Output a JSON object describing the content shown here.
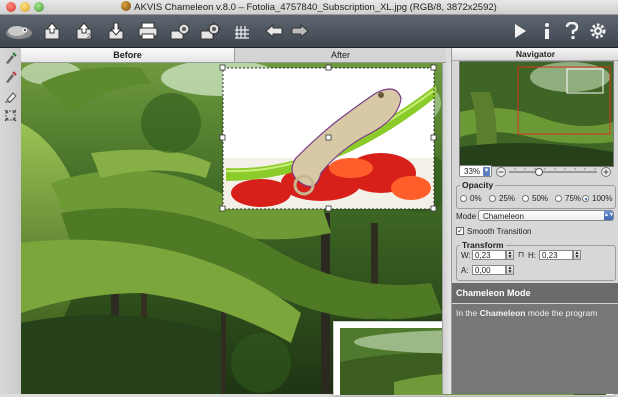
{
  "window": {
    "title": "AKVIS Chameleon v.8.0 – Fotolia_4757840_Subscription_XL.jpg (RGB/8, 3872x2592)"
  },
  "toolbar": {
    "left_icons": [
      "app-logo-icon",
      "open-icon",
      "save-icon",
      "import-icon",
      "print-icon",
      "preferences-icon",
      "settings-icon",
      "grid-icon",
      "undo-arrow-icon",
      "redo-arrow-icon"
    ],
    "right_icons": [
      "run-icon",
      "info-icon",
      "help-icon",
      "gear-icon"
    ]
  },
  "tabs": {
    "before": "Before",
    "after": "After"
  },
  "navigator": {
    "title": "Navigator",
    "zoom": "33%"
  },
  "opacity": {
    "label": "Opacity",
    "options": [
      "0%",
      "25%",
      "50%",
      "75%",
      "100%"
    ],
    "selected": "100%"
  },
  "mode": {
    "label": "Mode",
    "value": "Chameleon"
  },
  "smooth_transition": {
    "label": "Smooth Transition",
    "checked": true
  },
  "transform": {
    "label": "Transform",
    "w_label": "W:",
    "w_value": "0,23",
    "h_label": "H:",
    "h_value": "0,23",
    "a_label": "A:",
    "a_value": "0,00"
  },
  "help": {
    "title": "Chameleon Mode",
    "text_prefix": "In the ",
    "text_bold": "Chameleon",
    "text_suffix": " mode the program"
  },
  "colors": {
    "toolbar_bg": "#4a525b",
    "panel_bg": "#d7d7d7",
    "help_bg": "#6b6b6b"
  }
}
